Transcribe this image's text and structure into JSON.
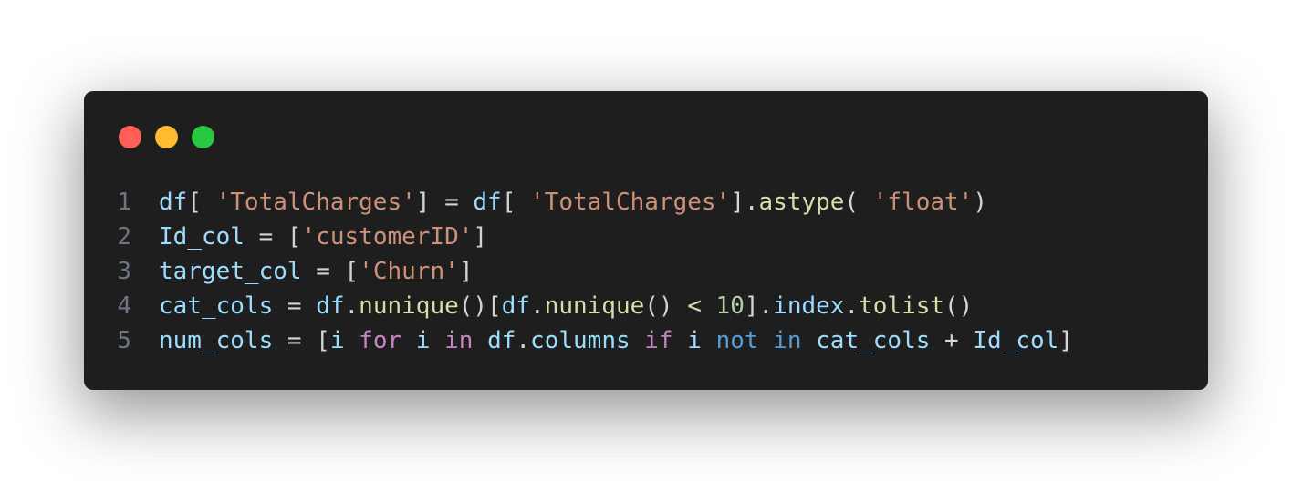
{
  "window": {
    "controls": [
      {
        "name": "close",
        "color": "#ff5f57"
      },
      {
        "name": "minimize",
        "color": "#febc2e"
      },
      {
        "name": "zoom",
        "color": "#28c840"
      }
    ]
  },
  "theme": {
    "background": "#1e1e1e",
    "line_number": "#6e7681",
    "variable": "#9cdcfe",
    "punctuation": "#d4d4d4",
    "string": "#ce9178",
    "function": "#dcdcaa",
    "number": "#b5cea8",
    "keyword": "#c586c0",
    "operator_keyword": "#569cd6"
  },
  "code": {
    "language": "python",
    "lines": [
      {
        "number": "1",
        "tokens": [
          {
            "t": "df",
            "c": "v"
          },
          {
            "t": "[ ",
            "c": "p"
          },
          {
            "t": "'TotalCharges'",
            "c": "s"
          },
          {
            "t": "] = ",
            "c": "p"
          },
          {
            "t": "df",
            "c": "v"
          },
          {
            "t": "[ ",
            "c": "p"
          },
          {
            "t": "'TotalCharges'",
            "c": "s"
          },
          {
            "t": "].",
            "c": "p"
          },
          {
            "t": "astype",
            "c": "f"
          },
          {
            "t": "( ",
            "c": "p"
          },
          {
            "t": "'float'",
            "c": "s"
          },
          {
            "t": ")",
            "c": "p"
          }
        ]
      },
      {
        "number": "2",
        "tokens": [
          {
            "t": "Id_col",
            "c": "v"
          },
          {
            "t": " = [",
            "c": "p"
          },
          {
            "t": "'customerID'",
            "c": "s"
          },
          {
            "t": "]",
            "c": "p"
          }
        ]
      },
      {
        "number": "3",
        "tokens": [
          {
            "t": "target_col",
            "c": "v"
          },
          {
            "t": " = [",
            "c": "p"
          },
          {
            "t": "'Churn'",
            "c": "s"
          },
          {
            "t": "]",
            "c": "p"
          }
        ]
      },
      {
        "number": "4",
        "tokens": [
          {
            "t": "cat_cols",
            "c": "v"
          },
          {
            "t": " = ",
            "c": "p"
          },
          {
            "t": "df",
            "c": "v"
          },
          {
            "t": ".",
            "c": "p"
          },
          {
            "t": "nunique",
            "c": "f"
          },
          {
            "t": "()[",
            "c": "p"
          },
          {
            "t": "df",
            "c": "v"
          },
          {
            "t": ".",
            "c": "p"
          },
          {
            "t": "nunique",
            "c": "f"
          },
          {
            "t": "() ",
            "c": "p"
          },
          {
            "t": "<",
            "c": "f"
          },
          {
            "t": " ",
            "c": "p"
          },
          {
            "t": "10",
            "c": "n"
          },
          {
            "t": "].",
            "c": "p"
          },
          {
            "t": "index",
            "c": "v"
          },
          {
            "t": ".",
            "c": "p"
          },
          {
            "t": "tolist",
            "c": "f"
          },
          {
            "t": "()",
            "c": "p"
          }
        ]
      },
      {
        "number": "5",
        "tokens": [
          {
            "t": "num_cols",
            "c": "v"
          },
          {
            "t": " = [",
            "c": "p"
          },
          {
            "t": "i",
            "c": "v"
          },
          {
            "t": " ",
            "c": "p"
          },
          {
            "t": "for",
            "c": "k"
          },
          {
            "t": " ",
            "c": "p"
          },
          {
            "t": "i",
            "c": "v"
          },
          {
            "t": " ",
            "c": "p"
          },
          {
            "t": "in",
            "c": "k"
          },
          {
            "t": " ",
            "c": "p"
          },
          {
            "t": "df",
            "c": "v"
          },
          {
            "t": ".",
            "c": "p"
          },
          {
            "t": "columns",
            "c": "v"
          },
          {
            "t": " ",
            "c": "p"
          },
          {
            "t": "if",
            "c": "k"
          },
          {
            "t": " ",
            "c": "p"
          },
          {
            "t": "i",
            "c": "v"
          },
          {
            "t": " ",
            "c": "p"
          },
          {
            "t": "not",
            "c": "k2"
          },
          {
            "t": " ",
            "c": "p"
          },
          {
            "t": "in",
            "c": "k2"
          },
          {
            "t": " ",
            "c": "p"
          },
          {
            "t": "cat_cols",
            "c": "v"
          },
          {
            "t": " + ",
            "c": "p"
          },
          {
            "t": "Id_col",
            "c": "v"
          },
          {
            "t": "]",
            "c": "p"
          }
        ]
      }
    ]
  }
}
